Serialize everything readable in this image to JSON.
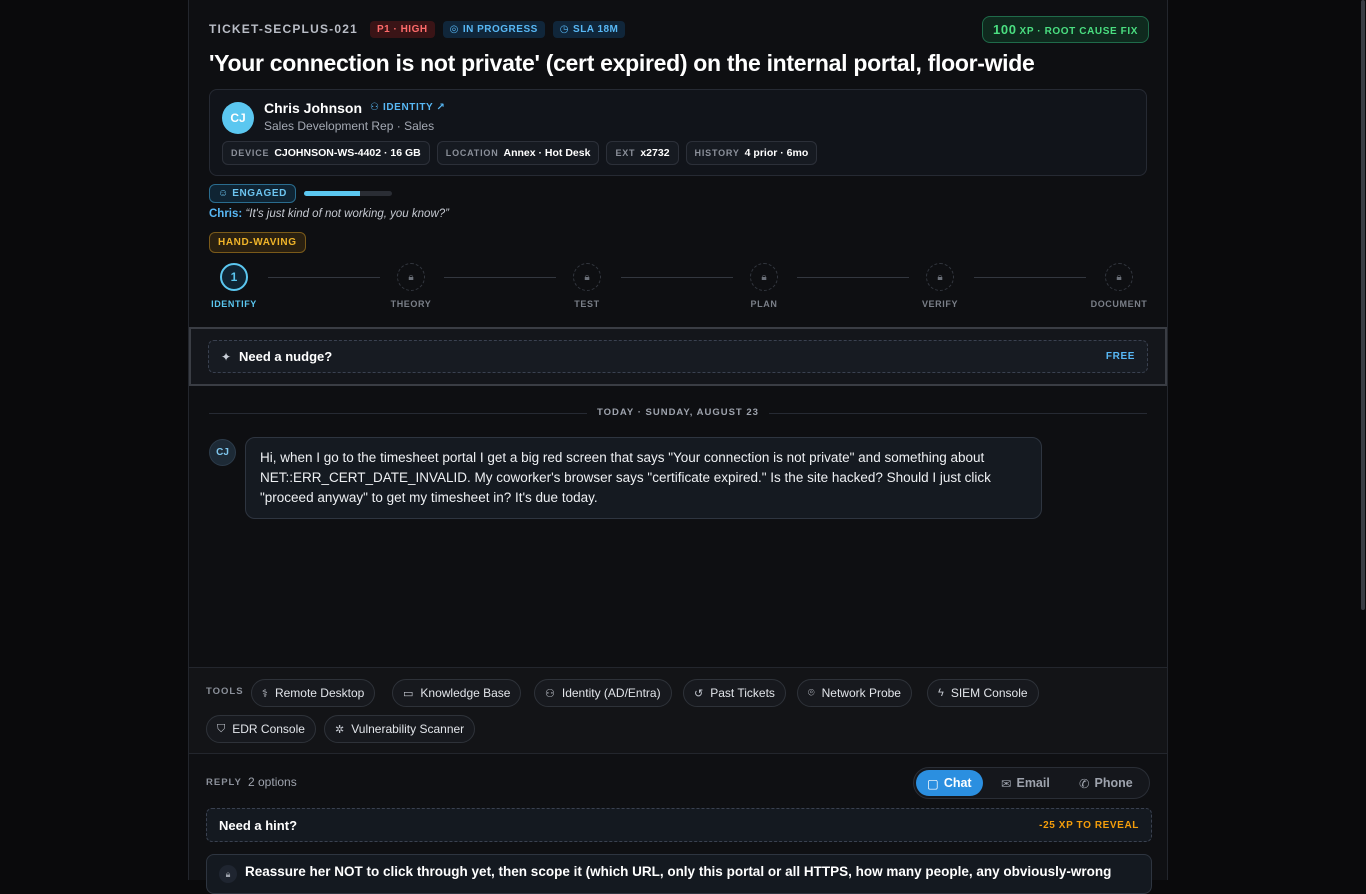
{
  "ticket": {
    "id": "TICKET-SECPLUS-021",
    "priority": "P1 · HIGH",
    "status": "IN PROGRESS",
    "sla": "SLA 18M",
    "xp_value": "100",
    "xp_label": "XP · ROOT CAUSE FIX",
    "title": "'Your connection is not private' (cert expired) on the internal portal, floor-wide"
  },
  "user": {
    "initials": "CJ",
    "name": "Chris Johnson",
    "identity_link": "IDENTITY",
    "role": "Sales Development Rep · Sales",
    "chips": [
      {
        "key": "DEVICE",
        "value": "CJOHNSON-WS-4402 · 16 GB"
      },
      {
        "key": "LOCATION",
        "value": "Annex · Hot Desk"
      },
      {
        "key": "EXT",
        "value": "x2732"
      },
      {
        "key": "HISTORY",
        "value": "4 prior · 6mo"
      }
    ]
  },
  "mood": {
    "label": "ENGAGED",
    "level": 0.64,
    "quote_who": "Chris:",
    "quote_text": "“It's just kind of not working, you know?”",
    "tag": "HAND-WAVING"
  },
  "steps": [
    {
      "label": "IDENTIFY",
      "number": "1",
      "active": true
    },
    {
      "label": "THEORY",
      "active": false
    },
    {
      "label": "TEST",
      "active": false
    },
    {
      "label": "PLAN",
      "active": false
    },
    {
      "label": "VERIFY",
      "active": false
    },
    {
      "label": "DOCUMENT",
      "active": false
    }
  ],
  "nudge": {
    "label": "Need a nudge?",
    "cost": "FREE"
  },
  "conversation": {
    "date_separator": "TODAY · SUNDAY, AUGUST 23",
    "messages": [
      {
        "from_initials": "CJ",
        "text": "Hi, when I go to the timesheet portal I get a big red screen that says \"Your connection is not private\" and something about NET::ERR_CERT_DATE_INVALID. My coworker's browser says \"certificate expired.\" Is the site hacked? Should I just click \"proceed anyway\" to get my timesheet in? It's due today."
      }
    ]
  },
  "tools": {
    "header": "TOOLS",
    "items": [
      {
        "label": "Remote Desktop",
        "icon": "stethoscope-icon"
      },
      {
        "label": "Knowledge Base",
        "icon": "book-icon"
      },
      {
        "label": "Identity (AD/Entra)",
        "icon": "user-icon"
      },
      {
        "label": "Past Tickets",
        "icon": "history-icon"
      },
      {
        "label": "Network Probe",
        "icon": "network-icon"
      },
      {
        "label": "SIEM Console",
        "icon": "bolt-icon"
      },
      {
        "label": "EDR Console",
        "icon": "shield-icon"
      },
      {
        "label": "Vulnerability Scanner",
        "icon": "bug-icon"
      }
    ]
  },
  "reply": {
    "header": "REPLY",
    "options_count": "2 options",
    "channels": [
      {
        "label": "Chat",
        "active": true
      },
      {
        "label": "Email",
        "active": false
      },
      {
        "label": "Phone",
        "active": false
      }
    ],
    "hint_label": "Need a hint?",
    "hint_cost": "-25 XP TO REVEAL",
    "first_option": "Reassure her NOT to click through yet, then scope it (which URL, only this portal or all HTTPS, how many people, any obviously-wrong"
  },
  "colors": {
    "accent": "#5bc7f0",
    "primary_button": "#2b8fe0",
    "priority_red": "#ff6b6b",
    "xp_green": "#4ade80",
    "warning_amber": "#f0b429"
  }
}
